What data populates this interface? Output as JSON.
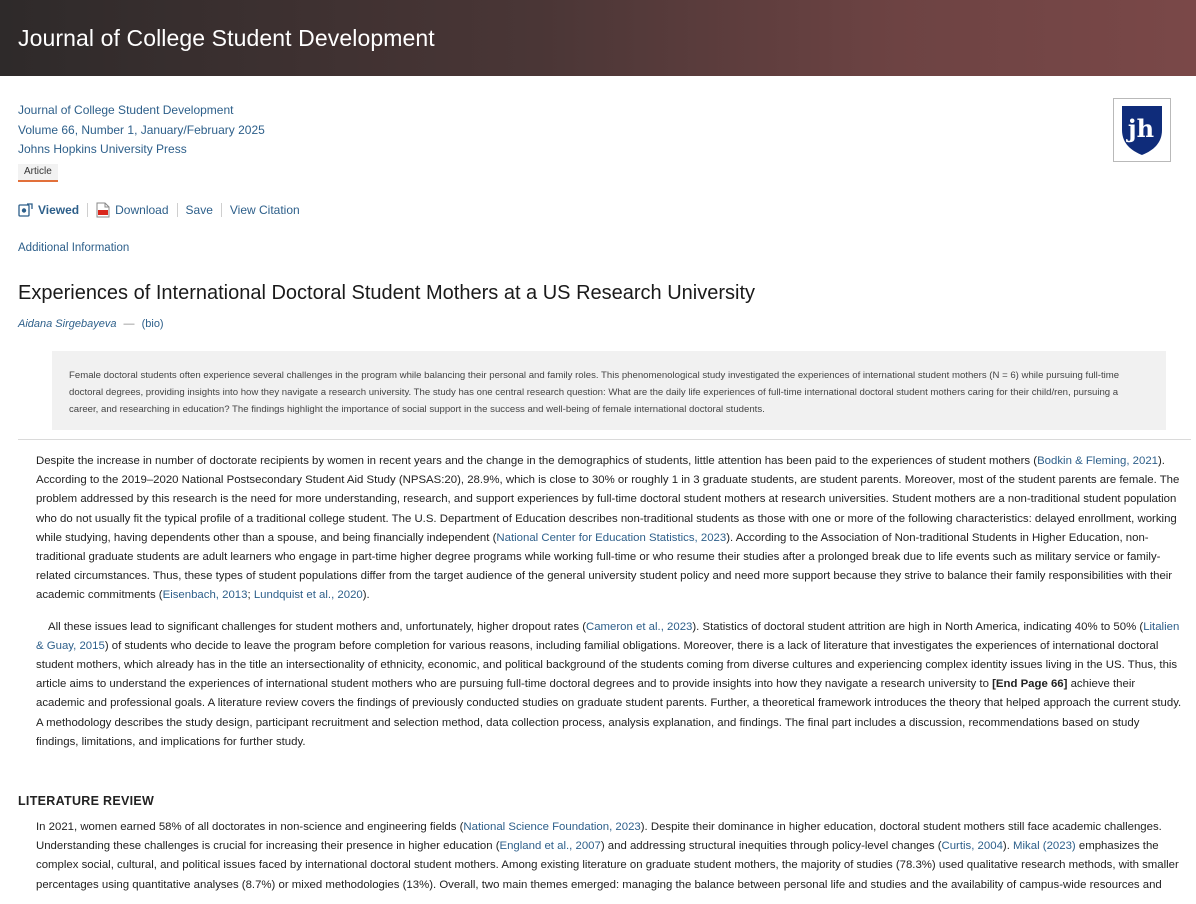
{
  "banner": {
    "title": "Journal of College Student Development"
  },
  "meta": {
    "journal": "Journal of College Student Development",
    "volume": "Volume 66, Number 1, January/February 2025",
    "publisher": "Johns Hopkins University Press",
    "badge": "Article",
    "logo_icon": "jh-shield-logo-icon"
  },
  "actions": {
    "viewed": "Viewed",
    "download": "Download",
    "save": "Save",
    "citation": "View Citation"
  },
  "additional_info": "Additional Information",
  "article": {
    "title": "Experiences of International Doctoral Student Mothers at a US Research University",
    "author": "Aidana Sirgebayeva",
    "dash": "—",
    "bio": "(bio)",
    "abstract": "Female doctoral students often experience several challenges in the program while balancing their personal and family roles. This phenomenological study investigated the experiences of international student mothers (N = 6) while pursuing full-time doctoral degrees, providing insights into how they navigate a research university. The study has one central research question: What are the daily life experiences of full-time international doctoral student mothers caring for their child/ren, pursuing a career, and researching in education? The findings highlight the importance of social support in the success and well-being of female international doctoral students."
  },
  "para1": {
    "t1": "Despite the increase in number of doctorate recipients by women in recent years and the change in the demographics of students, little attention has been paid to the experiences of student mothers (",
    "c1": "Bodkin & Fleming, 2021",
    "t2": "). According to the 2019–2020 National Postsecondary Student Aid Study (NPSAS:20), 28.9%, which is close to 30% or roughly 1 in 3 graduate students, are student parents. Moreover, most of the student parents are female. The problem addressed by this research is the need for more understanding, research, and support experiences by full-time doctoral student mothers at research universities. Student mothers are a non-traditional student population who do not usually fit the typical profile of a traditional college student. The U.S. Department of Education describes non-traditional students as those with one or more of the following characteristics: delayed enrollment, working while studying, having dependents other than a spouse, and being financially independent (",
    "c2": "National Center for Education Statistics, 2023",
    "t3": "). According to the Association of Non-traditional Students in Higher Education, non-traditional graduate students are adult learners who engage in part-time higher degree programs while working full-time or who resume their studies after a prolonged break due to life events such as military service or family-related circumstances. Thus, these types of student populations differ from the target audience of the general university student policy and need more support because they strive to balance their family responsibilities with their academic commitments (",
    "c3": "Eisenbach, 2013",
    "s1": "; ",
    "c4": "Lundquist et al., 2020",
    "t4": ")."
  },
  "para2": {
    "t1": "All these issues lead to significant challenges for student mothers and, unfortunately, higher dropout rates (",
    "c1": "Cameron et al., 2023",
    "t2": "). Statistics of doctoral student attrition are high in North America, indicating 40% to 50% (",
    "c2": "Litalien & Guay, 2015",
    "t3": ") of students who decide to leave the program before completion for various reasons, including familial obligations. Moreover, there is a lack of literature that investigates the experiences of international doctoral student mothers, which already has in the title an intersectionality of ethnicity, economic, and political background of the students coming from diverse cultures and experiencing complex identity issues living in the US. Thus, this article aims to understand the experiences of international student mothers who are pursuing full-time doctoral degrees and to provide insights into how they navigate a research university to ",
    "endpage": "[End Page 66]",
    "t4": " achieve their academic and professional goals. A literature review covers the findings of previously conducted studies on graduate student parents. Further, a theoretical framework introduces the theory that helped approach the current study. A methodology describes the study design, participant recruitment and selection method, data collection process, analysis explanation, and findings. The final part includes a discussion, recommendations based on study findings, limitations, and implications for further study."
  },
  "section": {
    "heading": "LITERATURE REVIEW",
    "t1": "In 2021, women earned 58% of all doctorates in non-science and engineering fields (",
    "c1": "National Science Foundation, 2023",
    "t2": "). Despite their dominance in higher education, doctoral student mothers still face academic challenges. Understanding these challenges is crucial for increasing their presence in higher education (",
    "c2": "England et al., 2007",
    "t3": ") and addressing structural inequities through policy-level changes (",
    "c3": "Curtis, 2004",
    "t4": "). ",
    "c4": "Mikal (2023)",
    "t5": " emphasizes the complex social, cultural, and political issues faced by international doctoral student mothers. Among existing literature on graduate student mothers, the majority of studies (78.3%) used qualitative research methods, with smaller percentages using quantitative analyses (8.7%) or mixed methodologies (13%). Overall, two main themes emerged: managing the balance between personal life and studies and the availability of campus-wide resources and"
  }
}
